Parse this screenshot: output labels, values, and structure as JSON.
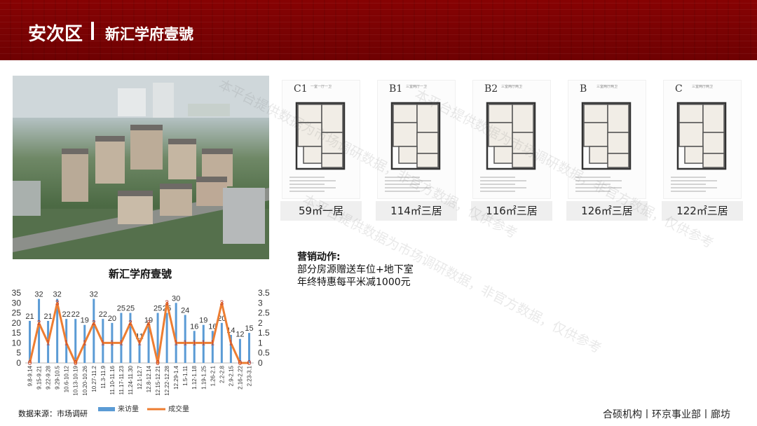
{
  "header": {
    "district": "安次区",
    "project": "新汇学府壹號"
  },
  "floor_plans": [
    {
      "code": "C1",
      "sub": "一室一厅一卫",
      "label": "59㎡一居"
    },
    {
      "code": "B1",
      "sub": "三室两厅一卫",
      "label": "114㎡三居"
    },
    {
      "code": "B2",
      "sub": "三室两厅两卫",
      "label": "116㎡三居"
    },
    {
      "code": "B",
      "sub": "三室两厅两卫",
      "label": "126㎡三居"
    },
    {
      "code": "C",
      "sub": "三室两厅两卫",
      "label": "122㎡三居"
    }
  ],
  "marketing": {
    "heading": "营销动作:",
    "line1": "部分房源赠送车位+地下室",
    "line2": "年终特惠每平米减1000元"
  },
  "source": "数据来源：市场调研",
  "footer": "合硕机构丨环京事业部丨廊坊",
  "watermark": "本平台提供数据为市场调研数据，非官方数据，仅供参考",
  "colors": {
    "header_red": "#b3151b",
    "visits_bar": "#5b9bd5",
    "deals_line": "#ed7d31",
    "deal_label": "#c0392b"
  },
  "chart_data": {
    "type": "bar",
    "title": "新汇学府壹號",
    "categories": [
      "9.8-9.14",
      "9.15-9.21",
      "9.22-9.28",
      "9.29-10.5",
      "10.6-10.12",
      "10.13-10.19",
      "10.20-10.26",
      "10.27-11.2",
      "11.3-11.9",
      "11.10-11.16",
      "11.17-11.23",
      "11.24-11.30",
      "12.1-12.7",
      "12.8-12.14",
      "12.15-12.21",
      "12.22-12.28",
      "12.29-1.4",
      "1.5-1.11",
      "1.12-1.18",
      "1.19-1.25",
      "1.26-2.1",
      "2.2-2.8",
      "2.9-2.15",
      "2.16-2.22",
      "2.23-3.1"
    ],
    "y_left": {
      "ticks": [
        "0",
        "5",
        "10",
        "15",
        "20",
        "25",
        "30",
        "35"
      ],
      "ylim": [
        0,
        35
      ]
    },
    "y_right": {
      "ticks": [
        "0",
        "0.5",
        "1",
        "1.5",
        "2",
        "2.5",
        "3",
        "3.5"
      ],
      "ylim": [
        0,
        3.5
      ]
    },
    "series": [
      {
        "name": "来访量",
        "kind": "bar",
        "axis": "left",
        "values": [
          21,
          32,
          21,
          32,
          22,
          22,
          19,
          32,
          22,
          20,
          25,
          25,
          11,
          19,
          25,
          25,
          30,
          24,
          16,
          19,
          16,
          20,
          14,
          12,
          15
        ]
      },
      {
        "name": "成交量",
        "kind": "line",
        "axis": "right",
        "values": [
          0,
          2,
          1,
          3,
          1,
          0,
          1,
          2,
          1,
          1,
          1,
          2,
          1,
          2,
          0,
          3,
          1,
          1,
          1,
          1,
          1,
          3,
          1,
          0,
          0
        ]
      }
    ],
    "legend_position": "bottom"
  }
}
